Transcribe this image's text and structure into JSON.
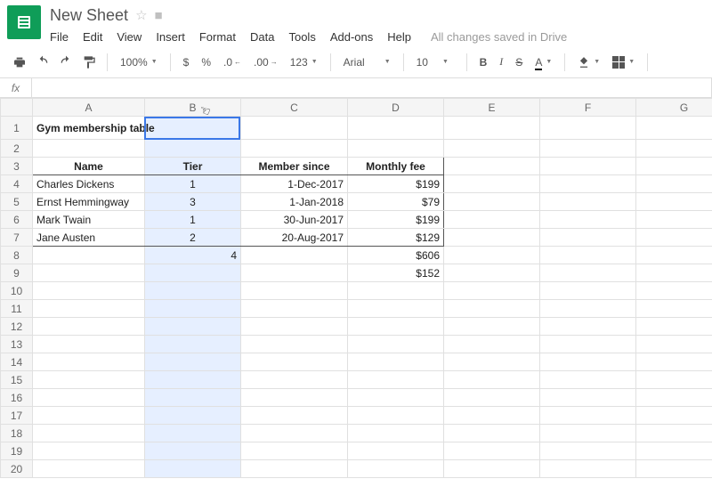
{
  "header": {
    "doc_title": "New Sheet",
    "status": "All changes saved in Drive",
    "menus": [
      "File",
      "Edit",
      "View",
      "Insert",
      "Format",
      "Data",
      "Tools",
      "Add-ons",
      "Help"
    ]
  },
  "toolbar": {
    "zoom": "100%",
    "dollar": "$",
    "percent": "%",
    "dec_less": ".0",
    "dec_more": ".00",
    "num_fmt": "123",
    "font_name": "Arial",
    "font_size": "10",
    "bold": "B",
    "italic": "I",
    "strike": "S",
    "text_color": "A"
  },
  "fx": {
    "label": "fx"
  },
  "columns": [
    "A",
    "B",
    "C",
    "D",
    "E",
    "F",
    "G"
  ],
  "rows_shown": 20,
  "selected_column": "B",
  "active_cell": "B1",
  "cells": {
    "A1": "Gym membership table",
    "A3": "Name",
    "B3": "Tier",
    "C3": "Member since",
    "D3": "Monthly fee",
    "A4": "Charles Dickens",
    "B4": "1",
    "C4": "1-Dec-2017",
    "D4": "$199",
    "A5": "Ernst Hemmingway",
    "B5": "3",
    "C5": "1-Jan-2018",
    "D5": "$79",
    "A6": "Mark Twain",
    "B6": "1",
    "C6": "30-Jun-2017",
    "D6": "$199",
    "A7": "Jane Austen",
    "B7": "2",
    "C7": "20-Aug-2017",
    "D7": "$129",
    "B8": "4",
    "D8": "$606",
    "D9": "$152"
  },
  "chart_data": {
    "type": "table",
    "title": "Gym membership table",
    "columns": [
      "Name",
      "Tier",
      "Member since",
      "Monthly fee"
    ],
    "rows": [
      [
        "Charles Dickens",
        1,
        "1-Dec-2017",
        199
      ],
      [
        "Ernst Hemmingway",
        3,
        "1-Jan-2018",
        79
      ],
      [
        "Mark Twain",
        1,
        "30-Jun-2017",
        199
      ],
      [
        "Jane Austen",
        2,
        "20-Aug-2017",
        129
      ]
    ],
    "summary": {
      "count": 4,
      "monthly_fee_total": 606,
      "monthly_fee_avg": 152
    }
  }
}
